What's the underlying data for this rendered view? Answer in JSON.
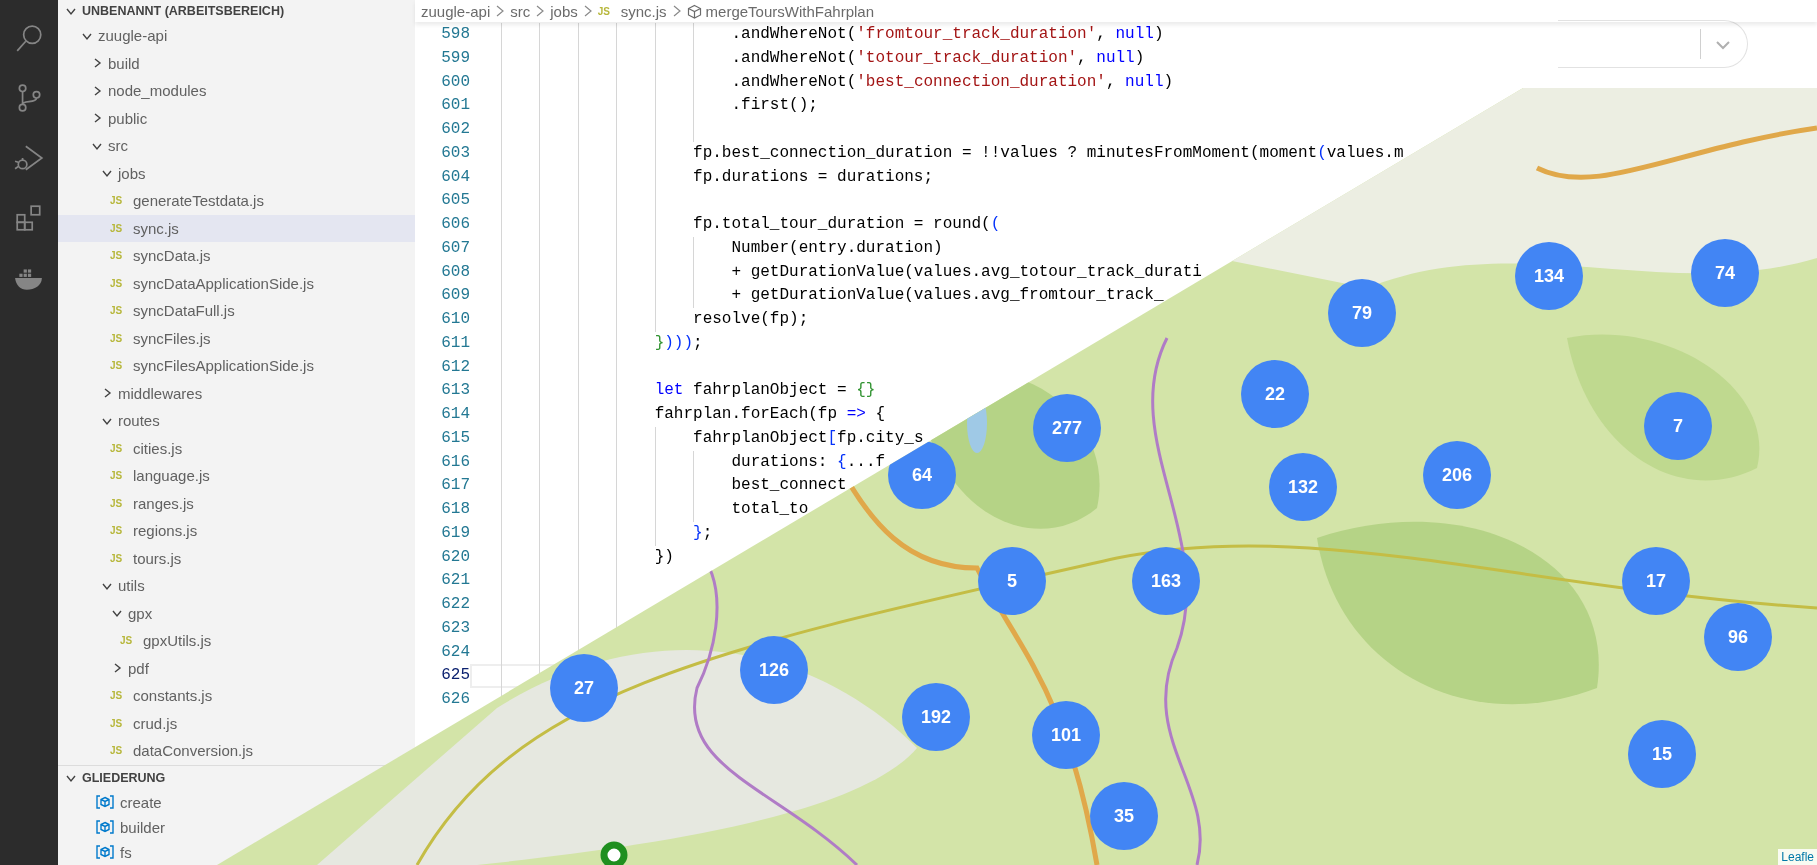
{
  "activity_bar": [
    {
      "kind": "search"
    },
    {
      "kind": "source-control"
    },
    {
      "kind": "run-debug"
    },
    {
      "kind": "extensions"
    },
    {
      "kind": "docker"
    }
  ],
  "explorer": {
    "title": "UNBENANNT (ARBEITSBEREICH)",
    "expanded": true,
    "items": [
      {
        "label": "zuugle-api",
        "kind": "folder",
        "expanded": true,
        "selected": false,
        "children": [
          {
            "label": "build",
            "kind": "folder",
            "expanded": false,
            "selected": false
          },
          {
            "label": "node_modules",
            "kind": "folder",
            "expanded": false,
            "selected": false
          },
          {
            "label": "public",
            "kind": "folder",
            "expanded": false,
            "selected": false
          },
          {
            "label": "src",
            "kind": "folder",
            "expanded": true,
            "selected": false,
            "children": [
              {
                "label": "jobs",
                "kind": "folder",
                "expanded": true,
                "selected": false,
                "children": [
                  {
                    "label": "generateTestdata.js",
                    "kind": "file",
                    "icon": "JS",
                    "selected": false
                  },
                  {
                    "label": "sync.js",
                    "kind": "file",
                    "icon": "JS",
                    "selected": true
                  },
                  {
                    "label": "syncData.js",
                    "kind": "file",
                    "icon": "JS",
                    "selected": false
                  },
                  {
                    "label": "syncDataApplicationSide.js",
                    "kind": "file",
                    "icon": "JS",
                    "selected": false
                  },
                  {
                    "label": "syncDataFull.js",
                    "kind": "file",
                    "icon": "JS",
                    "selected": false
                  },
                  {
                    "label": "syncFiles.js",
                    "kind": "file",
                    "icon": "JS",
                    "selected": false
                  },
                  {
                    "label": "syncFilesApplicationSide.js",
                    "kind": "file",
                    "icon": "JS",
                    "selected": false
                  }
                ]
              },
              {
                "label": "middlewares",
                "kind": "folder",
                "expanded": false,
                "selected": false
              },
              {
                "label": "routes",
                "kind": "folder",
                "expanded": true,
                "selected": false,
                "children": [
                  {
                    "label": "cities.js",
                    "kind": "file",
                    "icon": "JS",
                    "selected": false
                  },
                  {
                    "label": "language.js",
                    "kind": "file",
                    "icon": "JS",
                    "selected": false
                  },
                  {
                    "label": "ranges.js",
                    "kind": "file",
                    "icon": "JS",
                    "selected": false
                  },
                  {
                    "label": "regions.js",
                    "kind": "file",
                    "icon": "JS",
                    "selected": false
                  },
                  {
                    "label": "tours.js",
                    "kind": "file",
                    "icon": "JS",
                    "selected": false
                  }
                ]
              },
              {
                "label": "utils",
                "kind": "folder",
                "expanded": true,
                "selected": false,
                "children": [
                  {
                    "label": "gpx",
                    "kind": "folder",
                    "expanded": true,
                    "selected": false,
                    "children": [
                      {
                        "label": "gpxUtils.js",
                        "kind": "file",
                        "icon": "JS",
                        "selected": false
                      }
                    ]
                  },
                  {
                    "label": "pdf",
                    "kind": "folder",
                    "expanded": false,
                    "selected": false
                  },
                  {
                    "label": "constants.js",
                    "kind": "file",
                    "icon": "JS",
                    "selected": false
                  },
                  {
                    "label": "crud.js",
                    "kind": "file",
                    "icon": "JS",
                    "selected": false
                  },
                  {
                    "label": "dataConversion.js",
                    "kind": "file",
                    "icon": "JS",
                    "selected": false
                  }
                ]
              }
            ]
          }
        ]
      }
    ]
  },
  "outline": {
    "title": "GLIEDERUNG",
    "expanded": true,
    "items": [
      {
        "label": "create"
      },
      {
        "label": "builder"
      },
      {
        "label": "fs"
      }
    ]
  },
  "breadcrumb": [
    {
      "text": "zuugle-api",
      "kind": "folder"
    },
    {
      "text": "src",
      "kind": "folder"
    },
    {
      "text": "jobs",
      "kind": "folder"
    },
    {
      "text": "sync.js",
      "kind": "file",
      "icon": "JS"
    },
    {
      "text": "mergeToursWithFahrplan",
      "kind": "symbol"
    }
  ],
  "code_lines": [
    {
      "number": "598",
      "current": false,
      "tokens": [
        {
          "text": "                        .andWhereNot(",
          "kind": "plain"
        },
        {
          "text": "'fromtour_track_duration'",
          "kind": "string"
        },
        {
          "text": ", ",
          "kind": "plain"
        },
        {
          "text": "null",
          "kind": "keyword"
        },
        {
          "text": ")",
          "kind": "plain"
        }
      ]
    },
    {
      "number": "599",
      "current": false,
      "tokens": [
        {
          "text": "                        .andWhereNot(",
          "kind": "plain"
        },
        {
          "text": "'totour_track_duration'",
          "kind": "string"
        },
        {
          "text": ", ",
          "kind": "plain"
        },
        {
          "text": "null",
          "kind": "keyword"
        },
        {
          "text": ")",
          "kind": "plain"
        }
      ]
    },
    {
      "number": "600",
      "current": false,
      "tokens": [
        {
          "text": "                        .andWhereNot(",
          "kind": "plain"
        },
        {
          "text": "'best_connection_duration'",
          "kind": "string"
        },
        {
          "text": ", ",
          "kind": "plain"
        },
        {
          "text": "null",
          "kind": "keyword"
        },
        {
          "text": ")",
          "kind": "plain"
        }
      ]
    },
    {
      "number": "601",
      "current": false,
      "tokens": [
        {
          "text": "                        .first();",
          "kind": "plain"
        }
      ]
    },
    {
      "number": "602",
      "current": false
    },
    {
      "number": "603",
      "current": false,
      "tokens": [
        {
          "text": "                    fp.best_connection_duration = !!values ? minutesFromMoment(moment",
          "kind": "plain"
        },
        {
          "text": "(",
          "kind": "bracket1"
        },
        {
          "text": "values.m",
          "kind": "plain"
        }
      ]
    },
    {
      "number": "604",
      "current": false,
      "tokens": [
        {
          "text": "                    fp.durations = durations;",
          "kind": "plain"
        }
      ]
    },
    {
      "number": "605",
      "current": false
    },
    {
      "number": "606",
      "current": false,
      "tokens": [
        {
          "text": "                    fp.total_tour_duration = round(",
          "kind": "plain"
        },
        {
          "text": "(",
          "kind": "bracket1"
        }
      ]
    },
    {
      "number": "607",
      "current": false,
      "tokens": [
        {
          "text": "                        Number(entry.duration)",
          "kind": "plain"
        }
      ]
    },
    {
      "number": "608",
      "current": false,
      "tokens": [
        {
          "text": "                        + getDurationValue(values.avg_totour_track_durati",
          "kind": "plain"
        }
      ]
    },
    {
      "number": "609",
      "current": false,
      "tokens": [
        {
          "text": "                        + getDurationValue(values.avg_fromtour_track_",
          "kind": "plain"
        }
      ]
    },
    {
      "number": "610",
      "current": false,
      "tokens": [
        {
          "text": "                    resolve(fp);",
          "kind": "plain"
        }
      ]
    },
    {
      "number": "611",
      "current": false,
      "tokens": [
        {
          "text": "                }",
          "kind": "bracket2"
        },
        {
          "text": ")))",
          "kind": "bracket1"
        },
        {
          "text": ";",
          "kind": "plain"
        }
      ]
    },
    {
      "number": "612",
      "current": false
    },
    {
      "number": "613",
      "current": false,
      "tokens": [
        {
          "text": "                let",
          "kind": "keyword"
        },
        {
          "text": " fahrplanObject = ",
          "kind": "plain"
        },
        {
          "text": "{}",
          "kind": "bracket2"
        }
      ]
    },
    {
      "number": "614",
      "current": false,
      "tokens": [
        {
          "text": "                fahrplan.forEach(fp ",
          "kind": "plain"
        },
        {
          "text": "=>",
          "kind": "keyword"
        },
        {
          "text": " {",
          "kind": "plain"
        }
      ]
    },
    {
      "number": "615",
      "current": false,
      "tokens": [
        {
          "text": "                    fahrplanObject",
          "kind": "plain"
        },
        {
          "text": "[",
          "kind": "bracket1"
        },
        {
          "text": "fp.city_s",
          "kind": "plain"
        }
      ]
    },
    {
      "number": "616",
      "current": false,
      "tokens": [
        {
          "text": "                        durations: ",
          "kind": "plain"
        },
        {
          "text": "{",
          "kind": "bracket1"
        },
        {
          "text": "...f",
          "kind": "plain"
        }
      ]
    },
    {
      "number": "617",
      "current": false,
      "tokens": [
        {
          "text": "                        best_connect",
          "kind": "plain"
        }
      ]
    },
    {
      "number": "618",
      "current": false,
      "tokens": [
        {
          "text": "                        total_to",
          "kind": "plain"
        }
      ]
    },
    {
      "number": "619",
      "current": false,
      "tokens": [
        {
          "text": "                    }",
          "kind": "bracket1"
        },
        {
          "text": ";",
          "kind": "plain"
        }
      ]
    },
    {
      "number": "620",
      "current": false,
      "tokens": [
        {
          "text": "                })",
          "kind": "plain"
        }
      ]
    },
    {
      "number": "621",
      "current": false
    },
    {
      "number": "622",
      "current": false
    },
    {
      "number": "623",
      "current": false
    },
    {
      "number": "624",
      "current": false
    },
    {
      "number": "625",
      "current": true
    },
    {
      "number": "626",
      "current": false
    }
  ],
  "map": {
    "kind": "picture",
    "attribution": "Leafle",
    "clusters": [
      {
        "count": "79"
      },
      {
        "count": "134"
      },
      {
        "count": "74"
      },
      {
        "count": "22"
      },
      {
        "count": "7"
      },
      {
        "count": "277"
      },
      {
        "count": "132"
      },
      {
        "count": "206"
      },
      {
        "count": "64"
      },
      {
        "count": "5"
      },
      {
        "count": "163"
      },
      {
        "count": "17"
      },
      {
        "count": "96"
      },
      {
        "count": "126"
      },
      {
        "count": "27"
      },
      {
        "count": "192"
      },
      {
        "count": "101"
      },
      {
        "count": "35"
      },
      {
        "count": "15"
      }
    ]
  }
}
